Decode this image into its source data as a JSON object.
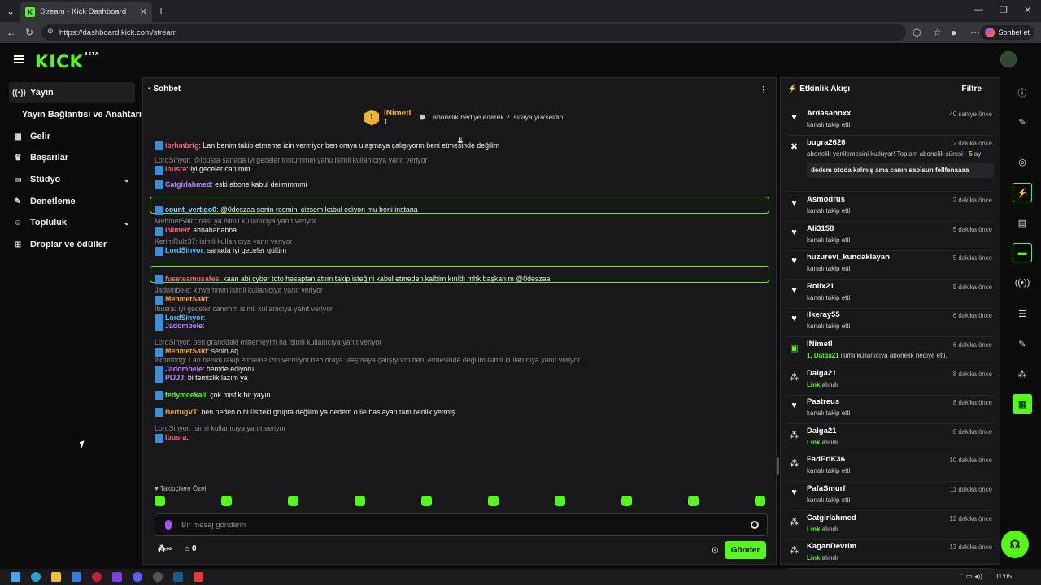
{
  "browser": {
    "tab_title": "Stream - Kick Dashboard",
    "url": "https://dashboard.kick.com/stream",
    "copilot_label": "Sohbet et"
  },
  "brand": {
    "logo": "KICK",
    "beta": "BETA",
    "accent": "#53fc18"
  },
  "sidebar": {
    "items": [
      {
        "label": "Yayın",
        "icon": "broadcast-icon",
        "active": true
      },
      {
        "label": "Yayın Bağlantısı ve Anahtarı",
        "icon": "",
        "active": false
      },
      {
        "label": "Gelir",
        "icon": "revenue-icon"
      },
      {
        "label": "Başarılar",
        "icon": "trophy-icon"
      },
      {
        "label": "Stüdyo",
        "icon": "studio-icon",
        "expandable": true
      },
      {
        "label": "Denetleme",
        "icon": "wrench-icon"
      },
      {
        "label": "Topluluk",
        "icon": "people-icon",
        "expandable": true
      },
      {
        "label": "Droplar ve ödüller",
        "icon": "gift-icon"
      }
    ]
  },
  "chat": {
    "title": "Sohbet",
    "pinned": {
      "rank": "1",
      "name": "INimetI",
      "count": "1",
      "text": "1 abonelik hediye ederek 2. sıraya yükseldin"
    },
    "messages": [
      {
        "reply": "",
        "user": "ibrhmbrtg",
        "user_color": "#ff5c7a",
        "text": ": Lan benim takip etmeme izin vermiyor ben oraya ulaşmaya çalışıyorm beni etmesinde değilim"
      },
      {
        "reply": "LordSinyor: @Ibusra sanada iyi geceler tostummm yahu isimli kullanıcıya yanıt veriyor",
        "user": "Ibusra",
        "user_color": "#ff5c7a",
        "text": ": iyi geceler canımm"
      },
      {
        "reply": "",
        "user": "Catgirlahmed",
        "user_color": "#c084fc",
        "text": ": eski abone kabul deilmmmmi"
      },
      {
        "reply": "",
        "user": "count_vertigo0",
        "user_color": "#9ad0ff",
        "text": ": @0deszaa senin resmini çizsem kabul ediyon mu beni instana",
        "highlight": true
      },
      {
        "reply": "MehmetSaid: nası ya isimli kullanıcıya yanıt veriyor",
        "user": "INimetI",
        "user_color": "#ff5c7a",
        "text": ": ahhahahahha"
      },
      {
        "reply": "KerimRulz37: isimli kullanıcıya yanıt veriyor",
        "user": "LordSinyor",
        "user_color": "#4fc3ff",
        "text": ": sanada iyi geceler gülüm"
      },
      {
        "reply": "",
        "user": "fuseteamusates",
        "user_color": "#ff5c7a",
        "text": ": kaan abi cyber toto hesaptan attım takip isteğini kabul etmeden kalbim kırıldı mhk başkanım @0deszaa",
        "highlight": true
      },
      {
        "reply": "Jadombele: kirwemmm isimli kullanıcıya yanıt veriyor",
        "user": "MehmetSaid",
        "user_color": "#f5a623",
        "text": ":"
      },
      {
        "reply": "Ibusra: iyi geceler canımm isimli kullanıcıya yanıt veriyor",
        "user": "LordSinyor",
        "user_color": "#4fc3ff",
        "text": ":"
      },
      {
        "reply": "",
        "user": "Jadombele",
        "user_color": "#c084fc",
        "text": ":"
      },
      {
        "reply": "LordSinyor: ben granddaki mihemeyim ha isimli kullanıcıya yanıt veriyor",
        "user": "MehmetSaid",
        "user_color": "#f5a623",
        "text": ": senin aq"
      },
      {
        "reply": "ibrhmbrtg: Lan benim takip etmeme izin vermiyor ben oraya ulaşmaya çalışıyorm beni etmesinde değilim isimli kullanıcıya yanıt veriyor",
        "user": "Jadombele",
        "user_color": "#c084fc",
        "text": ": bemde ediyoru"
      },
      {
        "reply": "",
        "user": "PIJJJ",
        "user_color": "#c084fc",
        "text": ": bi temizlik lazım ya"
      },
      {
        "reply": "",
        "user": "tedymcekali",
        "user_color": "#53fc18",
        "text": ": çok mistik bir yayın"
      },
      {
        "reply": "",
        "user": "BertugVT",
        "user_color": "#f5a623",
        "text": ": ben neden o bi üstteki grupta değilim ya dedem o ile baslayan tam benlik yermiş"
      },
      {
        "reply": "LordSinyor: isimli kullanıcıya yanıt veriyor",
        "user": "Ibusra",
        "user_color": "#ff5c7a",
        "text": ":"
      }
    ],
    "followers_only": "Takipçilere Özel",
    "input_placeholder": "Bir mesaj gönderin",
    "points": "0",
    "send_label": "Gönder"
  },
  "activity": {
    "title": "Etkinlik Akışı",
    "filter": "Filtre",
    "items": [
      {
        "icon": "heart-icon",
        "name": "Ardasahnxx",
        "time": "40 saniye önce",
        "desc": "kanalı takip etti"
      },
      {
        "icon": "resub-icon",
        "name": "bugra2626",
        "time": "2 dakika önce",
        "desc_a": "abonelik yenilemesini kutluyor! Toplam abonelik süresi - ",
        "desc_b": "5",
        "desc_c": "ay!",
        "quote": "dedem otoda kalmış ama canın saolsun fellfenaaaa"
      },
      {
        "icon": "heart-icon",
        "name": "Asmodrus",
        "time": "2 dakika önce",
        "desc": "kanalı takip etti"
      },
      {
        "icon": "heart-icon",
        "name": "Ali3158",
        "time": "5 dakika önce",
        "desc": "kanalı takip etti"
      },
      {
        "icon": "heart-icon",
        "name": "huzurevi_kundaklayan",
        "time": "5 dakika önce",
        "desc": "kanalı takip etti"
      },
      {
        "icon": "heart-icon",
        "name": "Rollx21",
        "time": "5 dakika önce",
        "desc": "kanalı takip etti"
      },
      {
        "icon": "heart-icon",
        "name": "ilkeray55",
        "time": "6 dakika önce",
        "desc": "kanalı takip etti"
      },
      {
        "icon": "gift-icon",
        "name": "INimetI",
        "time": "6 dakika önce",
        "desc_green": "1, Dalga21",
        "desc": " isimli kullanıcıya abonelik hediye etti."
      },
      {
        "icon": "link-icon",
        "name": "Dalga21",
        "time": "8 dakika önce",
        "desc_green": "Link",
        "desc": " alındı"
      },
      {
        "icon": "heart-icon",
        "name": "Pastreus",
        "time": "8 dakika önce",
        "desc": "kanalı takip etti"
      },
      {
        "icon": "link-icon",
        "name": "Dalga21",
        "time": "8 dakika önce",
        "desc_green": "Link",
        "desc": " alındı"
      },
      {
        "icon": "link-icon",
        "name": "FadEriK36",
        "time": "10 dakika önce",
        "desc": "kanalı takip etti"
      },
      {
        "icon": "heart-icon",
        "name": "PafaSmurf",
        "time": "11 dakika önce",
        "desc": "kanalı takip etti"
      },
      {
        "icon": "link-icon",
        "name": "Catgirlahmed",
        "time": "12 dakika önce",
        "desc_green": "Link",
        "desc": " alındı"
      },
      {
        "icon": "link-icon",
        "name": "KaganDevrim",
        "time": "13 dakika önce",
        "desc_green": "Link",
        "desc": " alındı"
      }
    ]
  },
  "taskbar": {
    "time": "01:05"
  }
}
